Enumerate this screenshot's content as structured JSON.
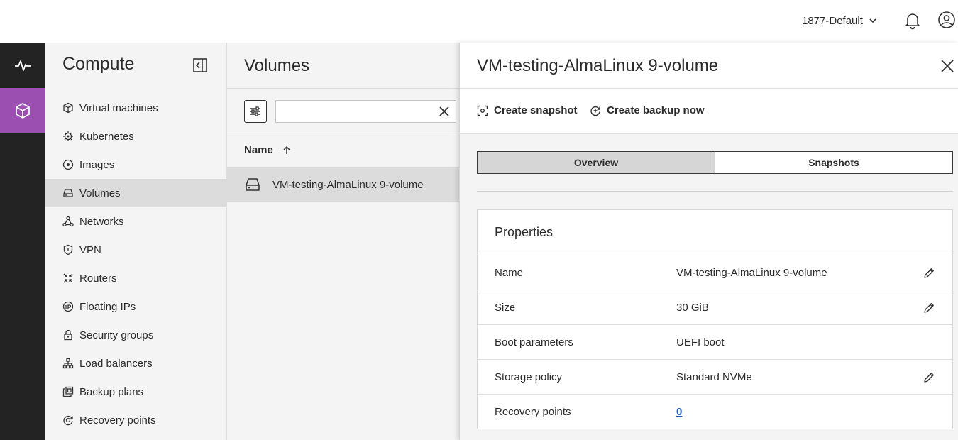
{
  "header": {
    "project": "1877-Default"
  },
  "rail": {
    "items": [
      {
        "icon": "activity-icon"
      },
      {
        "icon": "cube-icon",
        "active": true
      }
    ]
  },
  "sidebar": {
    "title": "Compute",
    "items": [
      {
        "label": "Virtual machines",
        "icon": "cube-icon"
      },
      {
        "label": "Kubernetes",
        "icon": "kubernetes-icon"
      },
      {
        "label": "Images",
        "icon": "disc-icon"
      },
      {
        "label": "Volumes",
        "icon": "drive-icon",
        "active": true
      },
      {
        "label": "Networks",
        "icon": "network-icon"
      },
      {
        "label": "VPN",
        "icon": "shield-icon"
      },
      {
        "label": "Routers",
        "icon": "router-icon"
      },
      {
        "label": "Floating IPs",
        "icon": "floating-ip-icon"
      },
      {
        "label": "Security groups",
        "icon": "lock-icon"
      },
      {
        "label": "Load balancers",
        "icon": "load-balancer-icon"
      },
      {
        "label": "Backup plans",
        "icon": "backup-icon"
      },
      {
        "label": "Recovery points",
        "icon": "recovery-icon"
      }
    ]
  },
  "list": {
    "title": "Volumes",
    "search": {
      "value": "",
      "placeholder": ""
    },
    "column_header": "Name",
    "rows": [
      {
        "name": "VM-testing-AlmaLinux 9-volume"
      }
    ]
  },
  "detail": {
    "title": "VM-testing-AlmaLinux 9-volume",
    "actions": {
      "create_snapshot": "Create snapshot",
      "create_backup": "Create backup now"
    },
    "tabs": [
      {
        "label": "Overview",
        "active": true
      },
      {
        "label": "Snapshots",
        "active": false
      }
    ],
    "properties": {
      "title": "Properties",
      "rows": [
        {
          "label": "Name",
          "value": "VM-testing-AlmaLinux 9-volume",
          "editable": true
        },
        {
          "label": "Size",
          "value": "30 GiB",
          "editable": true
        },
        {
          "label": "Boot parameters",
          "value": "UEFI boot",
          "editable": false
        },
        {
          "label": "Storage policy",
          "value": "Standard NVMe",
          "editable": true
        },
        {
          "label": "Recovery points",
          "value": "0",
          "editable": false,
          "link": true
        }
      ]
    }
  },
  "colors": {
    "rail_bg": "#232323",
    "rail_active": "#9b4fb0",
    "sidebar_bg": "#f4f4f4",
    "selected_bg": "#dcdcdc",
    "link": "#1a5fcc"
  }
}
